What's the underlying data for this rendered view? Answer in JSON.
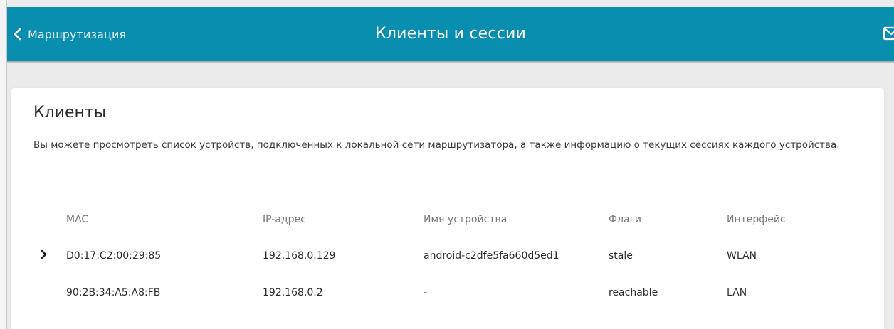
{
  "header": {
    "back_label": "Маршрутизация",
    "title": "Клиенты и сессии",
    "accent_color": "#0a8eaf"
  },
  "icons": {
    "back": "chevron-left-icon",
    "mail": "mail-icon",
    "expand": "chevron-right-icon"
  },
  "section": {
    "title": "Клиенты",
    "description": "Вы можете просмотреть список устройств, подключенных к локальной сети маршрутизатора, а также информацию о текущих сессиях каждого устройства."
  },
  "table": {
    "columns": [
      "MAC",
      "IP-адрес",
      "Имя устройства",
      "Флаги",
      "Интерфейс"
    ],
    "rows": [
      {
        "mac": "D0:17:C2:00:29:85",
        "ip": "192.168.0.129",
        "name": "android-c2dfe5fa660d5ed1",
        "flags": "stale",
        "interface": "WLAN",
        "expandable": true
      },
      {
        "mac": "90:2B:34:A5:A8:FB",
        "ip": "192.168.0.2",
        "name": "-",
        "flags": "reachable",
        "interface": "LAN",
        "expandable": false
      }
    ]
  }
}
